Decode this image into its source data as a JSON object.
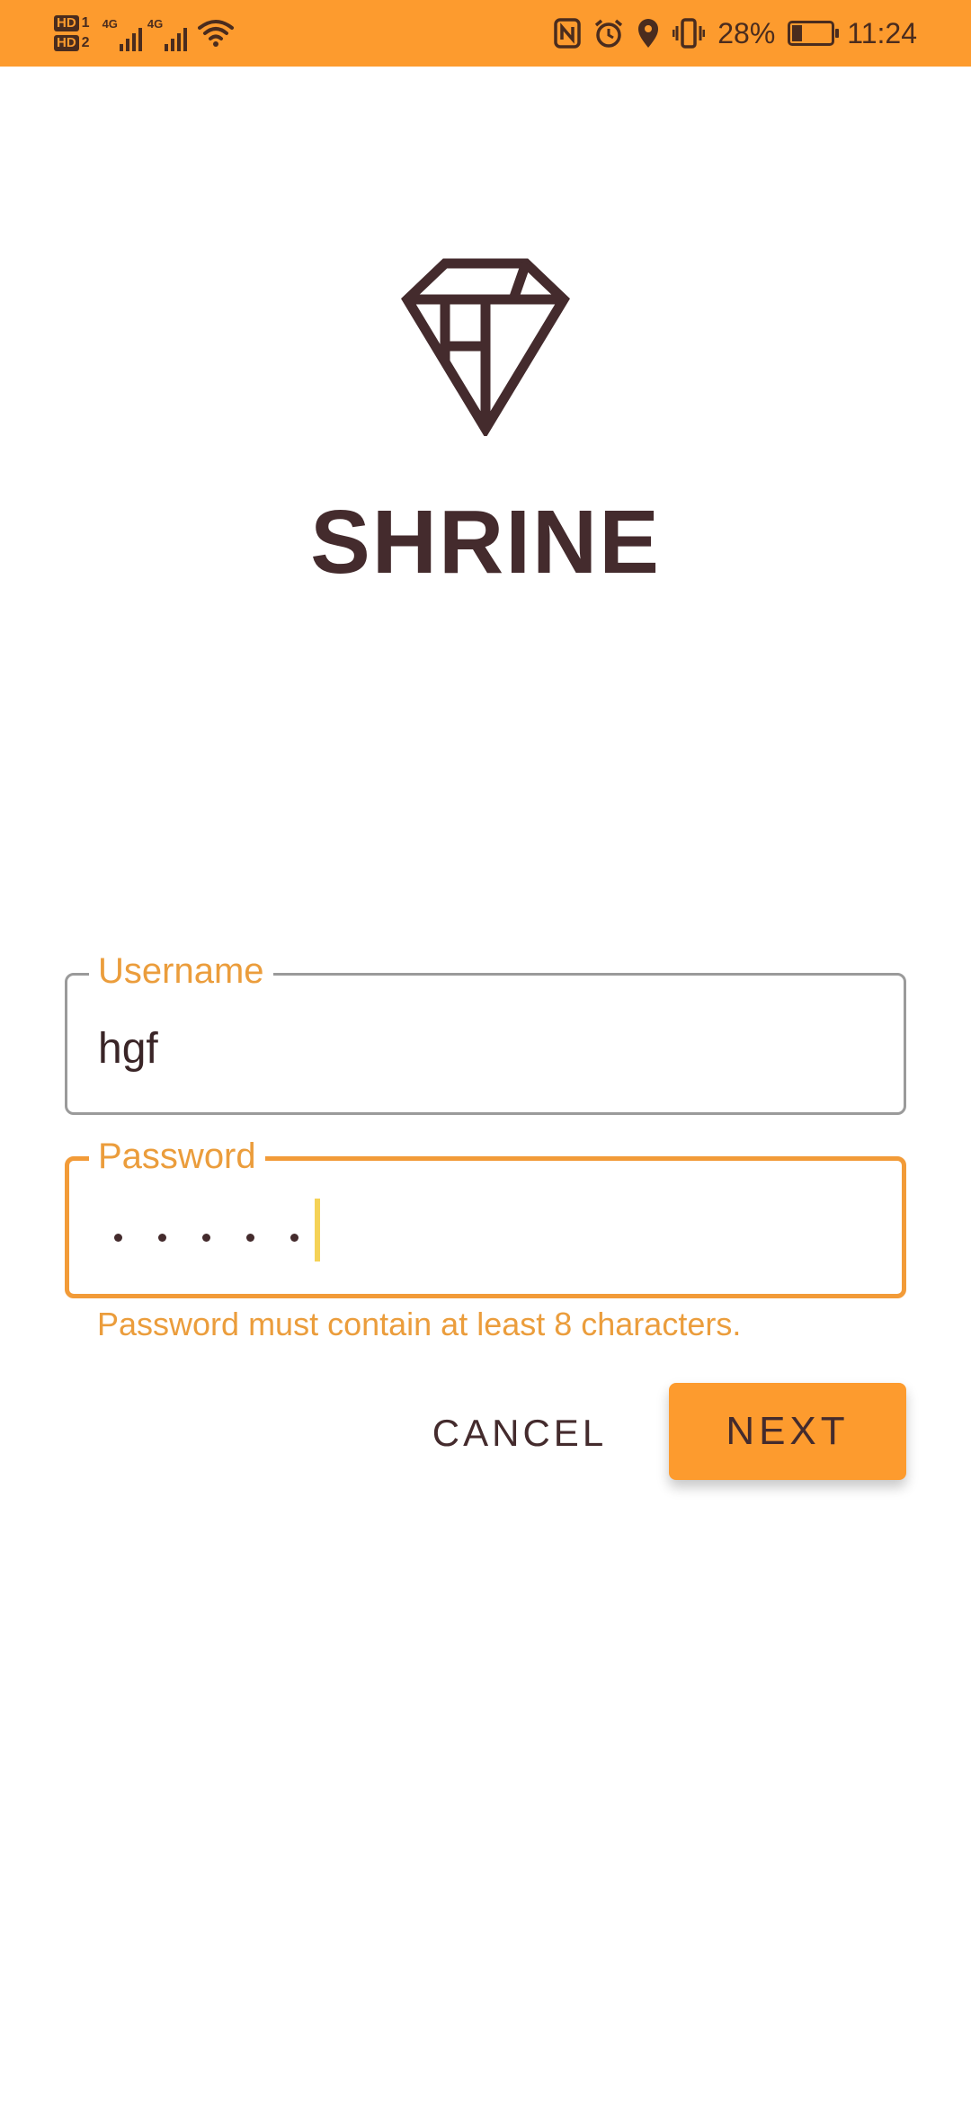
{
  "status_bar": {
    "sim1_badge": "HD",
    "sim1_num": "1",
    "sim2_badge": "HD",
    "sim2_num": "2",
    "network1": "4G",
    "network2": "4G",
    "battery_percent": "28%",
    "battery_level": 0.28,
    "time": "11:24",
    "icons": [
      "nfc-icon",
      "alarm-icon",
      "location-icon",
      "vibrate-icon",
      "battery-charging-icon",
      "wifi-icon",
      "signal-icon"
    ]
  },
  "app": {
    "title": "SHRINE",
    "logo": "diamond-logo-icon"
  },
  "form": {
    "username": {
      "label": "Username",
      "value": "hgf"
    },
    "password": {
      "label": "Password",
      "masked_length": 5,
      "helper_text": "Password must contain at least 8 characters."
    }
  },
  "actions": {
    "cancel_label": "CANCEL",
    "next_label": "NEXT"
  },
  "colors": {
    "accent": "#fd9b2e",
    "primary_text": "#442b2d",
    "error_label": "#eb9d3c",
    "focus_border": "#f29b38",
    "caret": "#f5d256",
    "idle_border": "#9a9a9a"
  }
}
